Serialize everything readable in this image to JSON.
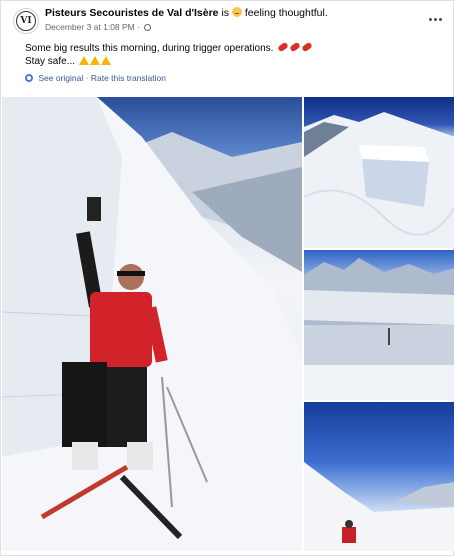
{
  "post": {
    "page_name": "Pisteurs Secouristes de Val d'Isère",
    "feeling_prefix": "is",
    "feeling": "feeling thoughtful.",
    "timestamp": "December 3 at 1:08 PM",
    "separator": "·",
    "avatar_text": "VI",
    "text_line1": "Some big results this morning, during trigger operations.",
    "text_line2": "Stay safe...",
    "see_original": "See original",
    "rate_translation": "Rate this translation",
    "dot": "·"
  },
  "icons": {
    "more": "more-horizontal-icon",
    "globe": "globe-icon",
    "translate": "translate-gear-icon",
    "chili": "chili-pepper-emoji",
    "warning": "warning-emoji",
    "feeling_emoji": "thoughtful-face-emoji"
  },
  "photos": [
    {
      "alt": "Rescuer in red jacket on skis beside avalanche fracture wall"
    },
    {
      "alt": "Avalanche fracture crown on slope"
    },
    {
      "alt": "Mountain panorama over avalanche debris"
    },
    {
      "alt": "Skier below snow slope under blue sky"
    }
  ]
}
